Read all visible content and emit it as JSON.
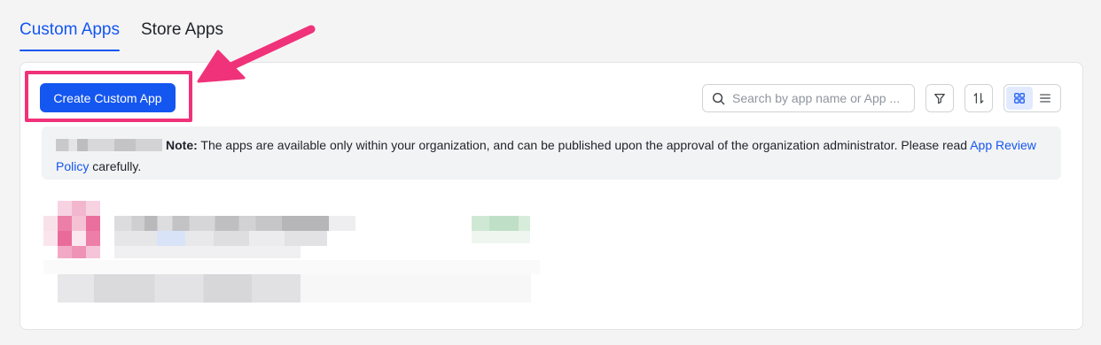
{
  "tabs": [
    {
      "label": "Custom Apps",
      "active": true
    },
    {
      "label": "Store Apps",
      "active": false
    }
  ],
  "toolbar": {
    "create_label": "Create Custom App",
    "search_placeholder": "Search by app name or App ...",
    "filter_icon": "filter-icon",
    "sort_icon": "sort-icon",
    "view_modes": [
      {
        "name": "grid-view-icon",
        "active": true
      },
      {
        "name": "list-view-icon",
        "active": false
      }
    ]
  },
  "notice": {
    "label": "Note:",
    "text": " The apps are available only within your organization, and can be published upon the approval of the organization administrator. Please read ",
    "link": "App Review Policy",
    "suffix": " carefully."
  },
  "colors": {
    "accent": "#1456f0",
    "annotation": "#f0327a",
    "panel_bg": "#ffffff",
    "page_bg": "#f4f4f5"
  }
}
